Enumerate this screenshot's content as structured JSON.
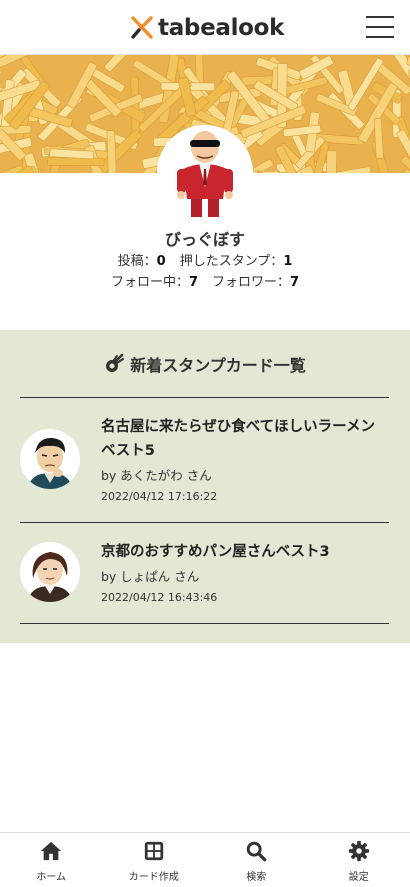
{
  "header": {
    "logo_text": "tabealook",
    "menu_icon": "hamburger-menu-icon"
  },
  "profile": {
    "name": "びっぐぼす",
    "posts_label": "投稿：",
    "posts_value": "0",
    "stamps_label": "押したスタンプ：",
    "stamps_value": "1",
    "following_label": "フォロー中：",
    "following_value": "7",
    "followers_label": "フォロワー：",
    "followers_value": "7"
  },
  "feed": {
    "title": "新着スタンプカード一覧",
    "title_icon": "meteor-icon",
    "cards": [
      {
        "title": "名古屋に来たらぜひ食べてほしいラーメンベスト5",
        "by": "by あくたがわ さん",
        "date": "2022/04/12 17:16:22"
      },
      {
        "title": "京都のおすすめパン屋さんベスト3",
        "by": "by しょぱん さん",
        "date": "2022/04/12 16:43:46"
      }
    ]
  },
  "nav": [
    {
      "label": "ホーム",
      "icon": "home-icon"
    },
    {
      "label": "カード作成",
      "icon": "grid-icon"
    },
    {
      "label": "検索",
      "icon": "search-icon"
    },
    {
      "label": "設定",
      "icon": "gear-icon"
    }
  ],
  "colors": {
    "accent_orange": "#f28c28",
    "feed_background": "#e2e8d4",
    "text_dark": "#222222"
  }
}
